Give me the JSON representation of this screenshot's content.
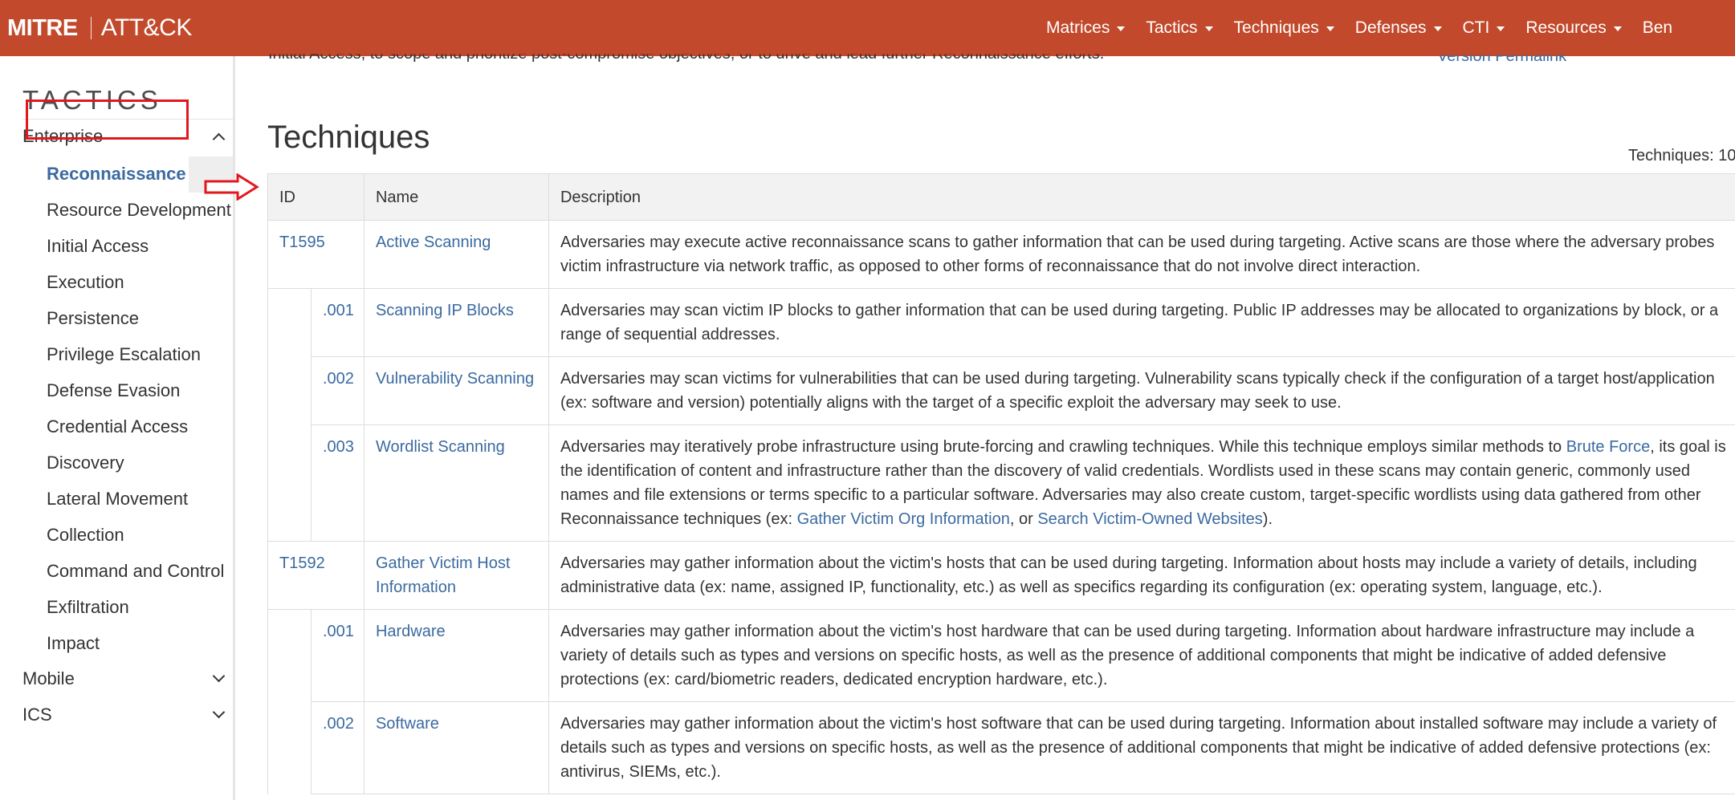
{
  "navbar": {
    "brand_left": "MITRE",
    "brand_right": "ATT&CK",
    "items": [
      {
        "label": "Matrices"
      },
      {
        "label": "Tactics"
      },
      {
        "label": "Techniques"
      },
      {
        "label": "Defenses"
      },
      {
        "label": "CTI"
      },
      {
        "label": "Resources"
      },
      {
        "label": "Ben"
      }
    ],
    "bg_color": "#c2492b"
  },
  "sidebar": {
    "heading": "TACTICS",
    "domains": [
      {
        "label": "Enterprise",
        "expanded": true
      },
      {
        "label": "Mobile",
        "expanded": false
      },
      {
        "label": "ICS",
        "expanded": false
      }
    ],
    "items": [
      {
        "label": "Reconnaissance",
        "active": true
      },
      {
        "label": "Resource Development"
      },
      {
        "label": "Initial Access"
      },
      {
        "label": "Execution"
      },
      {
        "label": "Persistence"
      },
      {
        "label": "Privilege Escalation"
      },
      {
        "label": "Defense Evasion"
      },
      {
        "label": "Credential Access"
      },
      {
        "label": "Discovery"
      },
      {
        "label": "Lateral Movement"
      },
      {
        "label": "Collection"
      },
      {
        "label": "Command and Control"
      },
      {
        "label": "Exfiltration"
      },
      {
        "label": "Impact"
      }
    ]
  },
  "main": {
    "top_cut_text": "Initial Access, to scope and prioritize post-compromise objectives, or to drive and lead further Reconnaissance efforts.",
    "permalink": "Version Permalink",
    "title": "Techniques",
    "count": "Techniques: 10",
    "table": {
      "headers": [
        "ID",
        "Name",
        "Description"
      ],
      "rows": [
        {
          "id": "T1595",
          "name": "Active Scanning",
          "description": "Adversaries may execute active reconnaissance scans to gather information that can be used during targeting. Active scans are those where the adversary probes victim infrastructure via network traffic, as opposed to other forms of reconnaissance that do not involve direct interaction."
        },
        {
          "sub": true,
          "id": ".001",
          "name": "Scanning IP Blocks",
          "description": "Adversaries may scan victim IP blocks to gather information that can be used during targeting. Public IP addresses may be allocated to organizations by block, or a range of sequential addresses."
        },
        {
          "sub": true,
          "id": ".002",
          "name": "Vulnerability Scanning",
          "description": "Adversaries may scan victims for vulnerabilities that can be used during targeting. Vulnerability scans typically check if the configuration of a target host/application (ex: software and version) potentially aligns with the target of a specific exploit the adversary may seek to use."
        },
        {
          "sub": true,
          "id": ".003",
          "name": "Wordlist Scanning",
          "description_parts": [
            "Adversaries may iteratively probe infrastructure using brute-forcing and crawling techniques. While this technique employs similar methods to ",
            "Brute Force",
            ", its goal is the identification of content and infrastructure rather than the discovery of valid credentials. Wordlists used in these scans may contain generic, commonly used names and file extensions or terms specific to a particular software. Adversaries may also create custom, target-specific wordlists using data gathered from other Reconnaissance techniques (ex: ",
            "Gather Victim Org Information",
            ", or ",
            "Search Victim-Owned Websites",
            ")."
          ]
        },
        {
          "id": "T1592",
          "name": "Gather Victim Host Information",
          "description": "Adversaries may gather information about the victim's hosts that can be used during targeting. Information about hosts may include a variety of details, including administrative data (ex: name, assigned IP, functionality, etc.) as well as specifics regarding its configuration (ex: operating system, language, etc.)."
        },
        {
          "sub": true,
          "id": ".001",
          "name": "Hardware",
          "description": "Adversaries may gather information about the victim's host hardware that can be used during targeting. Information about hardware infrastructure may include a variety of details such as types and versions on specific hosts, as well as the presence of additional components that might be indicative of added defensive protections (ex: card/biometric readers, dedicated encryption hardware, etc.)."
        },
        {
          "sub": true,
          "id": ".002",
          "name": "Software",
          "description": "Adversaries may gather information about the victim's host software that can be used during targeting. Information about installed software may include a variety of details such as types and versions on specific hosts, as well as the presence of additional components that might be indicative of added defensive protections (ex: antivirus, SIEMs, etc.)."
        }
      ]
    }
  },
  "colors": {
    "link": "#3b6aa0",
    "annotation": "#e3171d",
    "header_bg": "#f2f2f2"
  }
}
